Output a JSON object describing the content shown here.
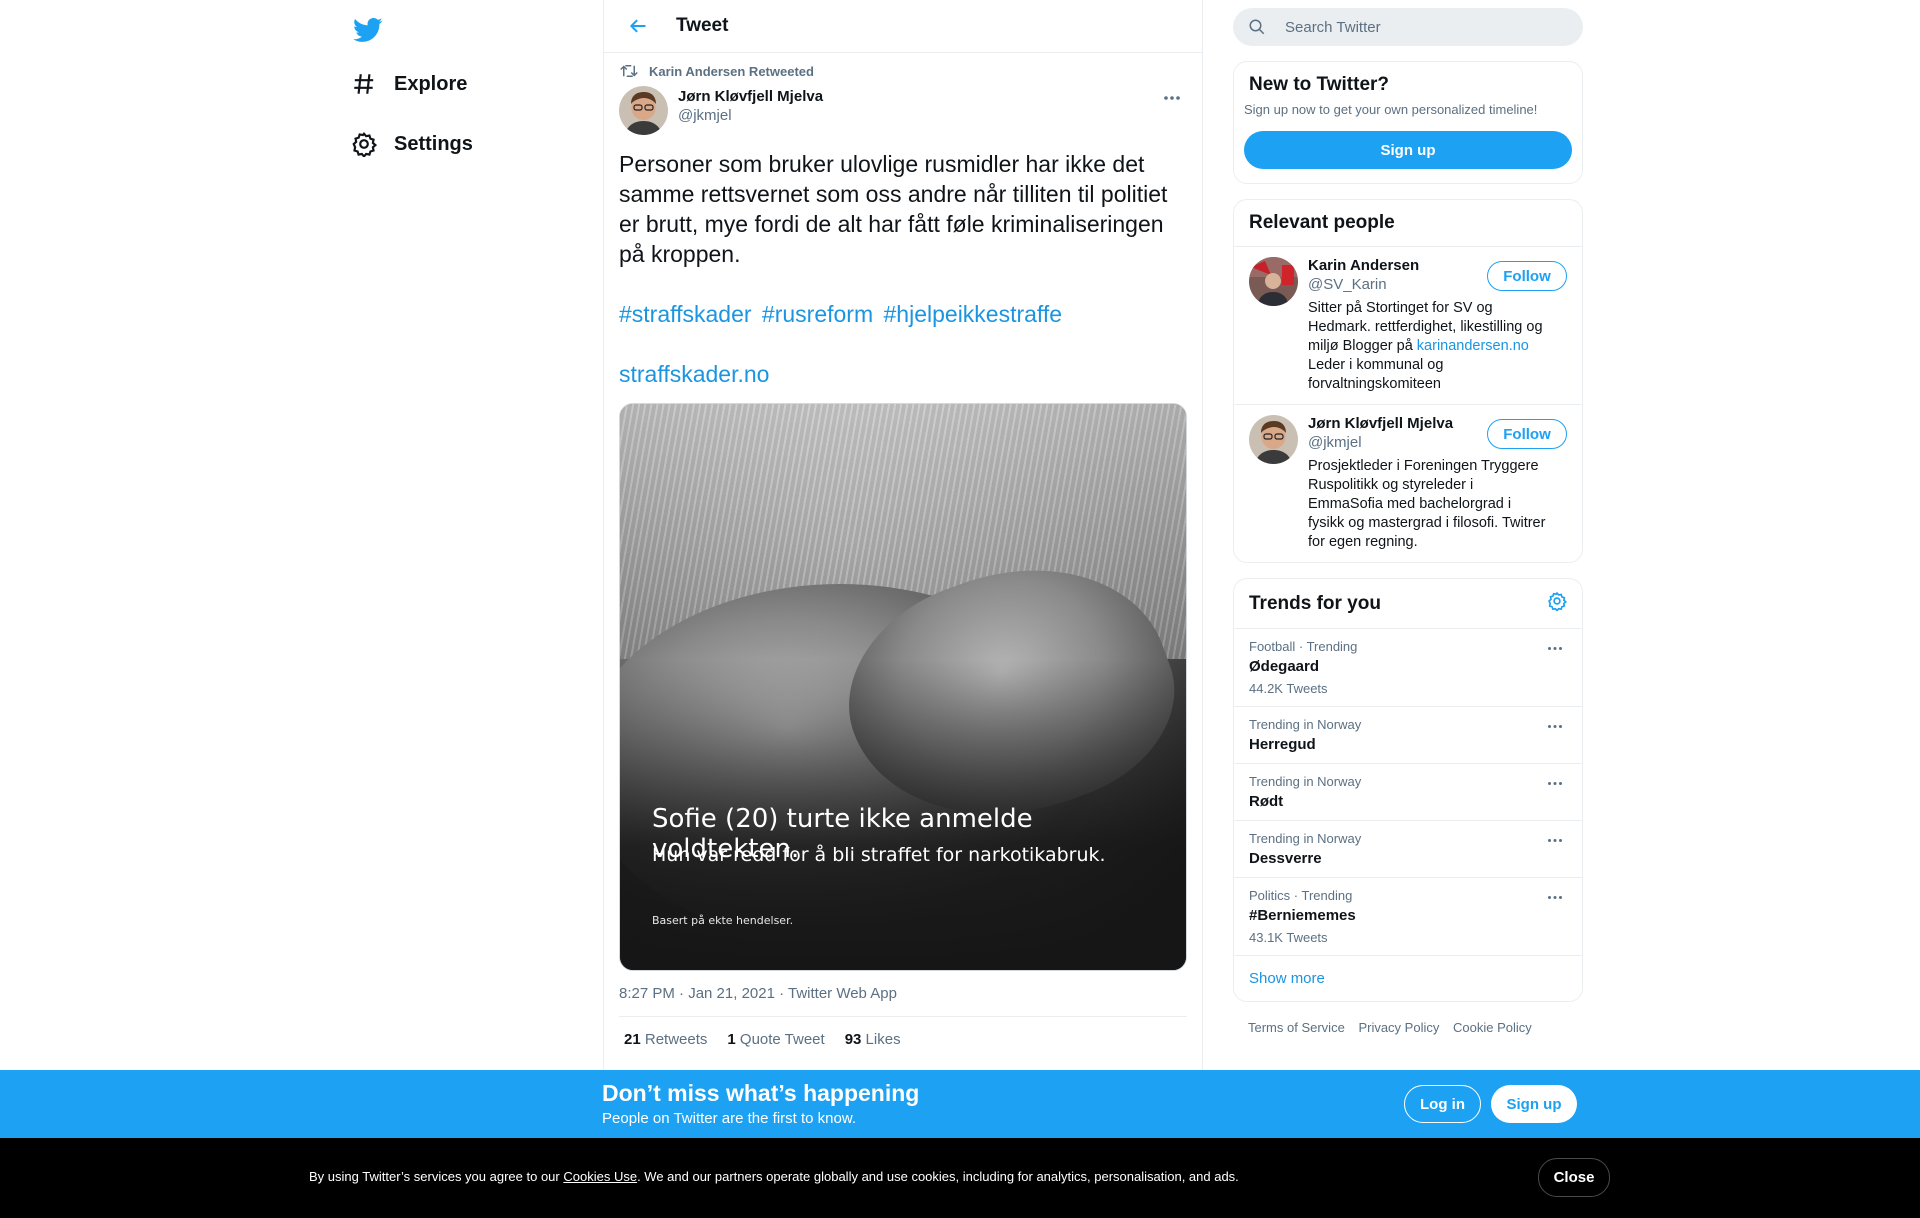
{
  "nav": {
    "items": [
      {
        "label": "Explore",
        "icon": "hashtag-icon"
      },
      {
        "label": "Settings",
        "icon": "gear-icon"
      }
    ]
  },
  "header": {
    "title": "Tweet"
  },
  "tweet": {
    "retweeted_by": "Karin Andersen Retweeted",
    "author_name": "Jørn Kløvfjell Mjelva",
    "author_handle": "@jkmjel",
    "text": "Personer som bruker ulovlige rusmidler har ikke det samme rettsvernet som oss andre når tilliten til politiet er brutt, mye fordi de alt har fått føle kriminaliseringen på kroppen.",
    "hashtags": [
      "#straffskader",
      "#rusreform",
      "#hjelpeikkestraffe"
    ],
    "url": "straffskader.no",
    "image": {
      "caption_main": "Sofie (20) turte ikke anmelde voldtekten.",
      "caption_sub": "Hun var redd for å bli straffet for narkotikabruk.",
      "caption_small": "Basert på ekte hendelser."
    },
    "meta": "8:27 PM · Jan 21, 2021 · Twitter Web App",
    "stats": {
      "retweets_count": "21",
      "retweets_label": "Retweets",
      "quote_count": "1",
      "quote_label": "Quote Tweet",
      "likes_count": "93",
      "likes_label": "Likes"
    }
  },
  "search": {
    "placeholder": "Search Twitter"
  },
  "new_to_twitter": {
    "title": "New to Twitter?",
    "subtitle": "Sign up now to get your own personalized timeline!",
    "button": "Sign up"
  },
  "relevant_people": {
    "title": "Relevant people",
    "people": [
      {
        "name": "Karin Andersen",
        "handle": "@SV_Karin",
        "bio_before": "Sitter på Stortinget for SV og Hedmark. rettferdighet, likestilling og miljø Blogger på ",
        "bio_link": "karinandersen.no",
        "bio_after": " Leder i kommunal og forvaltningskomiteen",
        "follow": "Follow"
      },
      {
        "name": "Jørn Kløvfjell Mjelva",
        "handle": "@jkmjel",
        "bio": "Prosjektleder i Foreningen Tryggere Ruspolitikk og styreleder i EmmaSofia med bachelorgrad i fysikk og mastergrad i filosofi. Twitrer for egen regning.",
        "follow": "Follow"
      }
    ]
  },
  "trends": {
    "title": "Trends for you",
    "items": [
      {
        "context": "Football · Trending",
        "name": "Ødegaard",
        "count": "44.2K Tweets"
      },
      {
        "context": "Trending in Norway",
        "name": "Herregud",
        "count": ""
      },
      {
        "context": "Trending in Norway",
        "name": "Rødt",
        "count": ""
      },
      {
        "context": "Trending in Norway",
        "name": "Dessverre",
        "count": ""
      },
      {
        "context": "Politics · Trending",
        "name": "#Berniememes",
        "count": "43.1K Tweets"
      }
    ],
    "show_more": "Show more"
  },
  "footer": {
    "links": [
      "Terms of Service",
      "Privacy Policy",
      "Cookie Policy"
    ]
  },
  "bottom_bar": {
    "title": "Don’t miss what’s happening",
    "subtitle": "People on Twitter are the first to know.",
    "login": "Log in",
    "signup": "Sign up"
  },
  "cookie": {
    "text_before": "By using Twitter’s services you agree to our ",
    "link": "Cookies Use",
    "text_after": ". We and our partners operate globally and use cookies, including for analytics, personalisation, and ads.",
    "close": "Close"
  },
  "colors": {
    "accent": "#1da1f2",
    "link": "#1b95e0",
    "muted": "#5b7083",
    "cookie_bg": "#000000"
  }
}
